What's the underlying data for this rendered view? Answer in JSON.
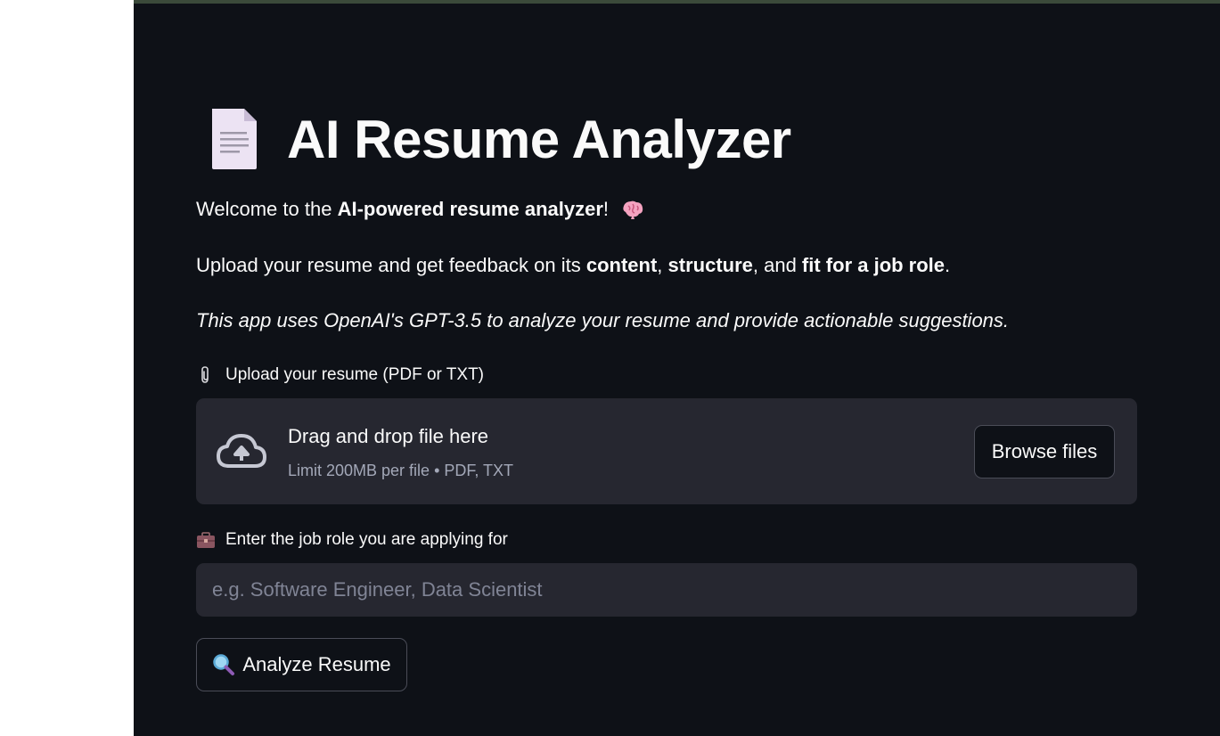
{
  "header": {
    "title": "AI Resume Analyzer",
    "title_icon": "page-document-icon"
  },
  "intro": {
    "welcome_prefix": "Welcome to the ",
    "welcome_bold": "AI-powered resume analyzer",
    "welcome_suffix": "!",
    "welcome_icon": "brain-icon",
    "upload_prefix": "Upload your resume and get feedback on its ",
    "upload_bold_1": "content",
    "upload_sep_1": ", ",
    "upload_bold_2": "structure",
    "upload_sep_2": ", and ",
    "upload_bold_3": "fit for a job role",
    "upload_suffix": ".",
    "note": "This app uses OpenAI's GPT-3.5 to analyze your resume and provide actionable suggestions."
  },
  "upload": {
    "label": "Upload your resume (PDF or TXT)",
    "label_icon": "paperclip-icon",
    "dropzone_title": "Drag and drop file here",
    "dropzone_limit": "Limit 200MB per file • PDF, TXT",
    "browse_label": "Browse files",
    "dropzone_icon": "cloud-upload-icon"
  },
  "job_role": {
    "label": "Enter the job role you are applying for",
    "label_icon": "briefcase-icon",
    "value": "",
    "placeholder": "e.g. Software Engineer, Data Scientist"
  },
  "actions": {
    "analyze_label": "Analyze Resume",
    "analyze_icon": "magnifier-icon"
  },
  "colors": {
    "background": "#0e1117",
    "surface": "#262730",
    "text": "#fafafa",
    "muted": "#a3a8b8"
  }
}
